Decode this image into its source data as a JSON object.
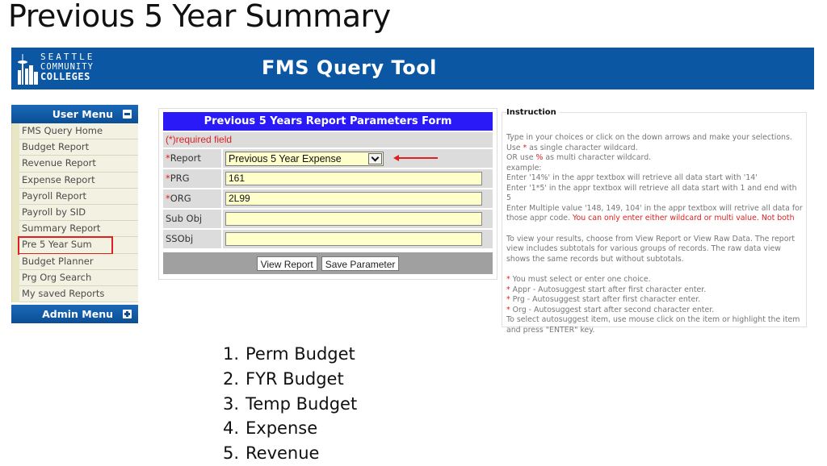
{
  "slide": {
    "title": "Previous 5 Year Summary"
  },
  "banner": {
    "logo_lines": [
      "SEATTLE",
      "COMMUNITY",
      "COLLEGES"
    ],
    "title": "FMS Query Tool",
    "color": "#0b57a4"
  },
  "user_menu": {
    "title": "User Menu",
    "toggle_icon": "minus-icon",
    "items": [
      {
        "label": "FMS Query Home"
      },
      {
        "label": "Budget Report"
      },
      {
        "label": "Revenue Report"
      },
      {
        "label": "Expense Report"
      },
      {
        "label": "Payroll Report"
      },
      {
        "label": "Payroll by SID"
      },
      {
        "label": "Summary Report"
      },
      {
        "label": "Pre 5 Year Sum",
        "highlighted": true
      },
      {
        "label": "Budget Planner"
      },
      {
        "label": "Prg Org Search"
      },
      {
        "label": "My saved Reports"
      }
    ]
  },
  "admin_menu": {
    "title": "Admin Menu",
    "toggle_icon": "plus-icon"
  },
  "form": {
    "title": "Previous 5 Years Report Parameters Form",
    "required_note": "(*)required field",
    "fields": {
      "report": {
        "required": "*",
        "label": "Report",
        "value": "Previous 5 Year Expense"
      },
      "prg": {
        "required": "*",
        "label": "PRG",
        "value": "161"
      },
      "org": {
        "required": "*",
        "label": "ORG",
        "value": "2L99"
      },
      "sub_obj": {
        "label": "Sub Obj",
        "value": ""
      },
      "ssobj": {
        "label": "SSObj",
        "value": ""
      }
    },
    "buttons": {
      "view_report": "View Report",
      "save_parameter": "Save Parameter"
    },
    "header_color": "#2a1af7"
  },
  "instruction": {
    "title": "Instruction",
    "line1": "Type in your choices or click on the down arrows and make your selections.",
    "line2_pre": "Use ",
    "line2_mark": "*",
    "line2_post": " as single character wildcard.",
    "line3_pre": "OR use ",
    "line3_mark": "%",
    "line3_post": " as multi character wildcard.",
    "line4": "example:",
    "line5": "Enter '14%' in the appr textbox will retrieve all data start with '14'",
    "line6": "Enter '1*5' in the appr textbox will retrieve all data start with 1 and end with 5",
    "line7": "Enter Multiple value '148, 149, 104' in the appr textbox will retrive all data for those appr code. ",
    "line7_warning": "You can only enter either wildcard or multi value. Not both",
    "para2": "To view your results, choose from View Report or View Raw Data. The report view includes subtotals for various groups of records. The raw data view shows the same records but without subtotals.",
    "notes": [
      "You must select or enter one choice.",
      "Appr - Autosuggest start after first character enter.",
      "Prg - Autosuggest start after first character enter.",
      "Org - Autosuggest start after second character enter."
    ],
    "note_mark": "*",
    "footer": "To select autosuggest item, use mouse click on the item or highlight the item and press \"ENTER\" key."
  },
  "report_types": [
    {
      "num": "1.",
      "label": "Perm Budget"
    },
    {
      "num": "2.",
      "label": "FYR Budget"
    },
    {
      "num": "3.",
      "label": "Temp Budget"
    },
    {
      "num": "4.",
      "label": "Expense"
    },
    {
      "num": "5.",
      "label": "Revenue"
    }
  ]
}
